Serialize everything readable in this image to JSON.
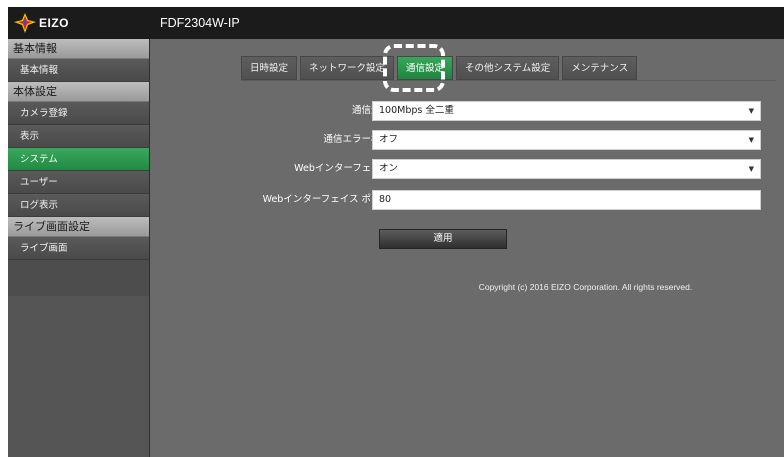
{
  "header": {
    "logo_text": "EIZO",
    "model": "FDF2304W-IP"
  },
  "sidebar": {
    "sections": [
      {
        "label": "基本情報",
        "items": [
          {
            "label": "基本情報"
          }
        ]
      },
      {
        "label": "本体設定",
        "items": [
          {
            "label": "カメラ登録"
          },
          {
            "label": "表示"
          },
          {
            "label": "システム",
            "active": true
          },
          {
            "label": "ユーザー"
          },
          {
            "label": "ログ表示"
          }
        ]
      },
      {
        "label": "ライブ画面設定",
        "items": [
          {
            "label": "ライブ画面"
          }
        ]
      }
    ]
  },
  "tabs": [
    {
      "label": "日時設定"
    },
    {
      "label": "ネットワーク設定"
    },
    {
      "label": "通信設定",
      "active": true
    },
    {
      "label": "その他システム設定"
    },
    {
      "label": "メンテナンス"
    }
  ],
  "form": {
    "comm_speed": {
      "label": "通信速度",
      "value": "100Mbps 全二重"
    },
    "comm_error": {
      "label": "通信エラー検知",
      "value": "オフ"
    },
    "web_interface": {
      "label": "Webインターフェイス",
      "value": "オン"
    },
    "web_port": {
      "label": "Webインターフェイス ポート",
      "value": "80"
    }
  },
  "apply_label": "適用",
  "copyright": "Copyright (c) 2016 EIZO Corporation. All rights reserved.",
  "colors": {
    "accent_green": "#2e9a4f",
    "header_bg": "#1b1b1b",
    "content_bg": "#6b6b6b"
  }
}
